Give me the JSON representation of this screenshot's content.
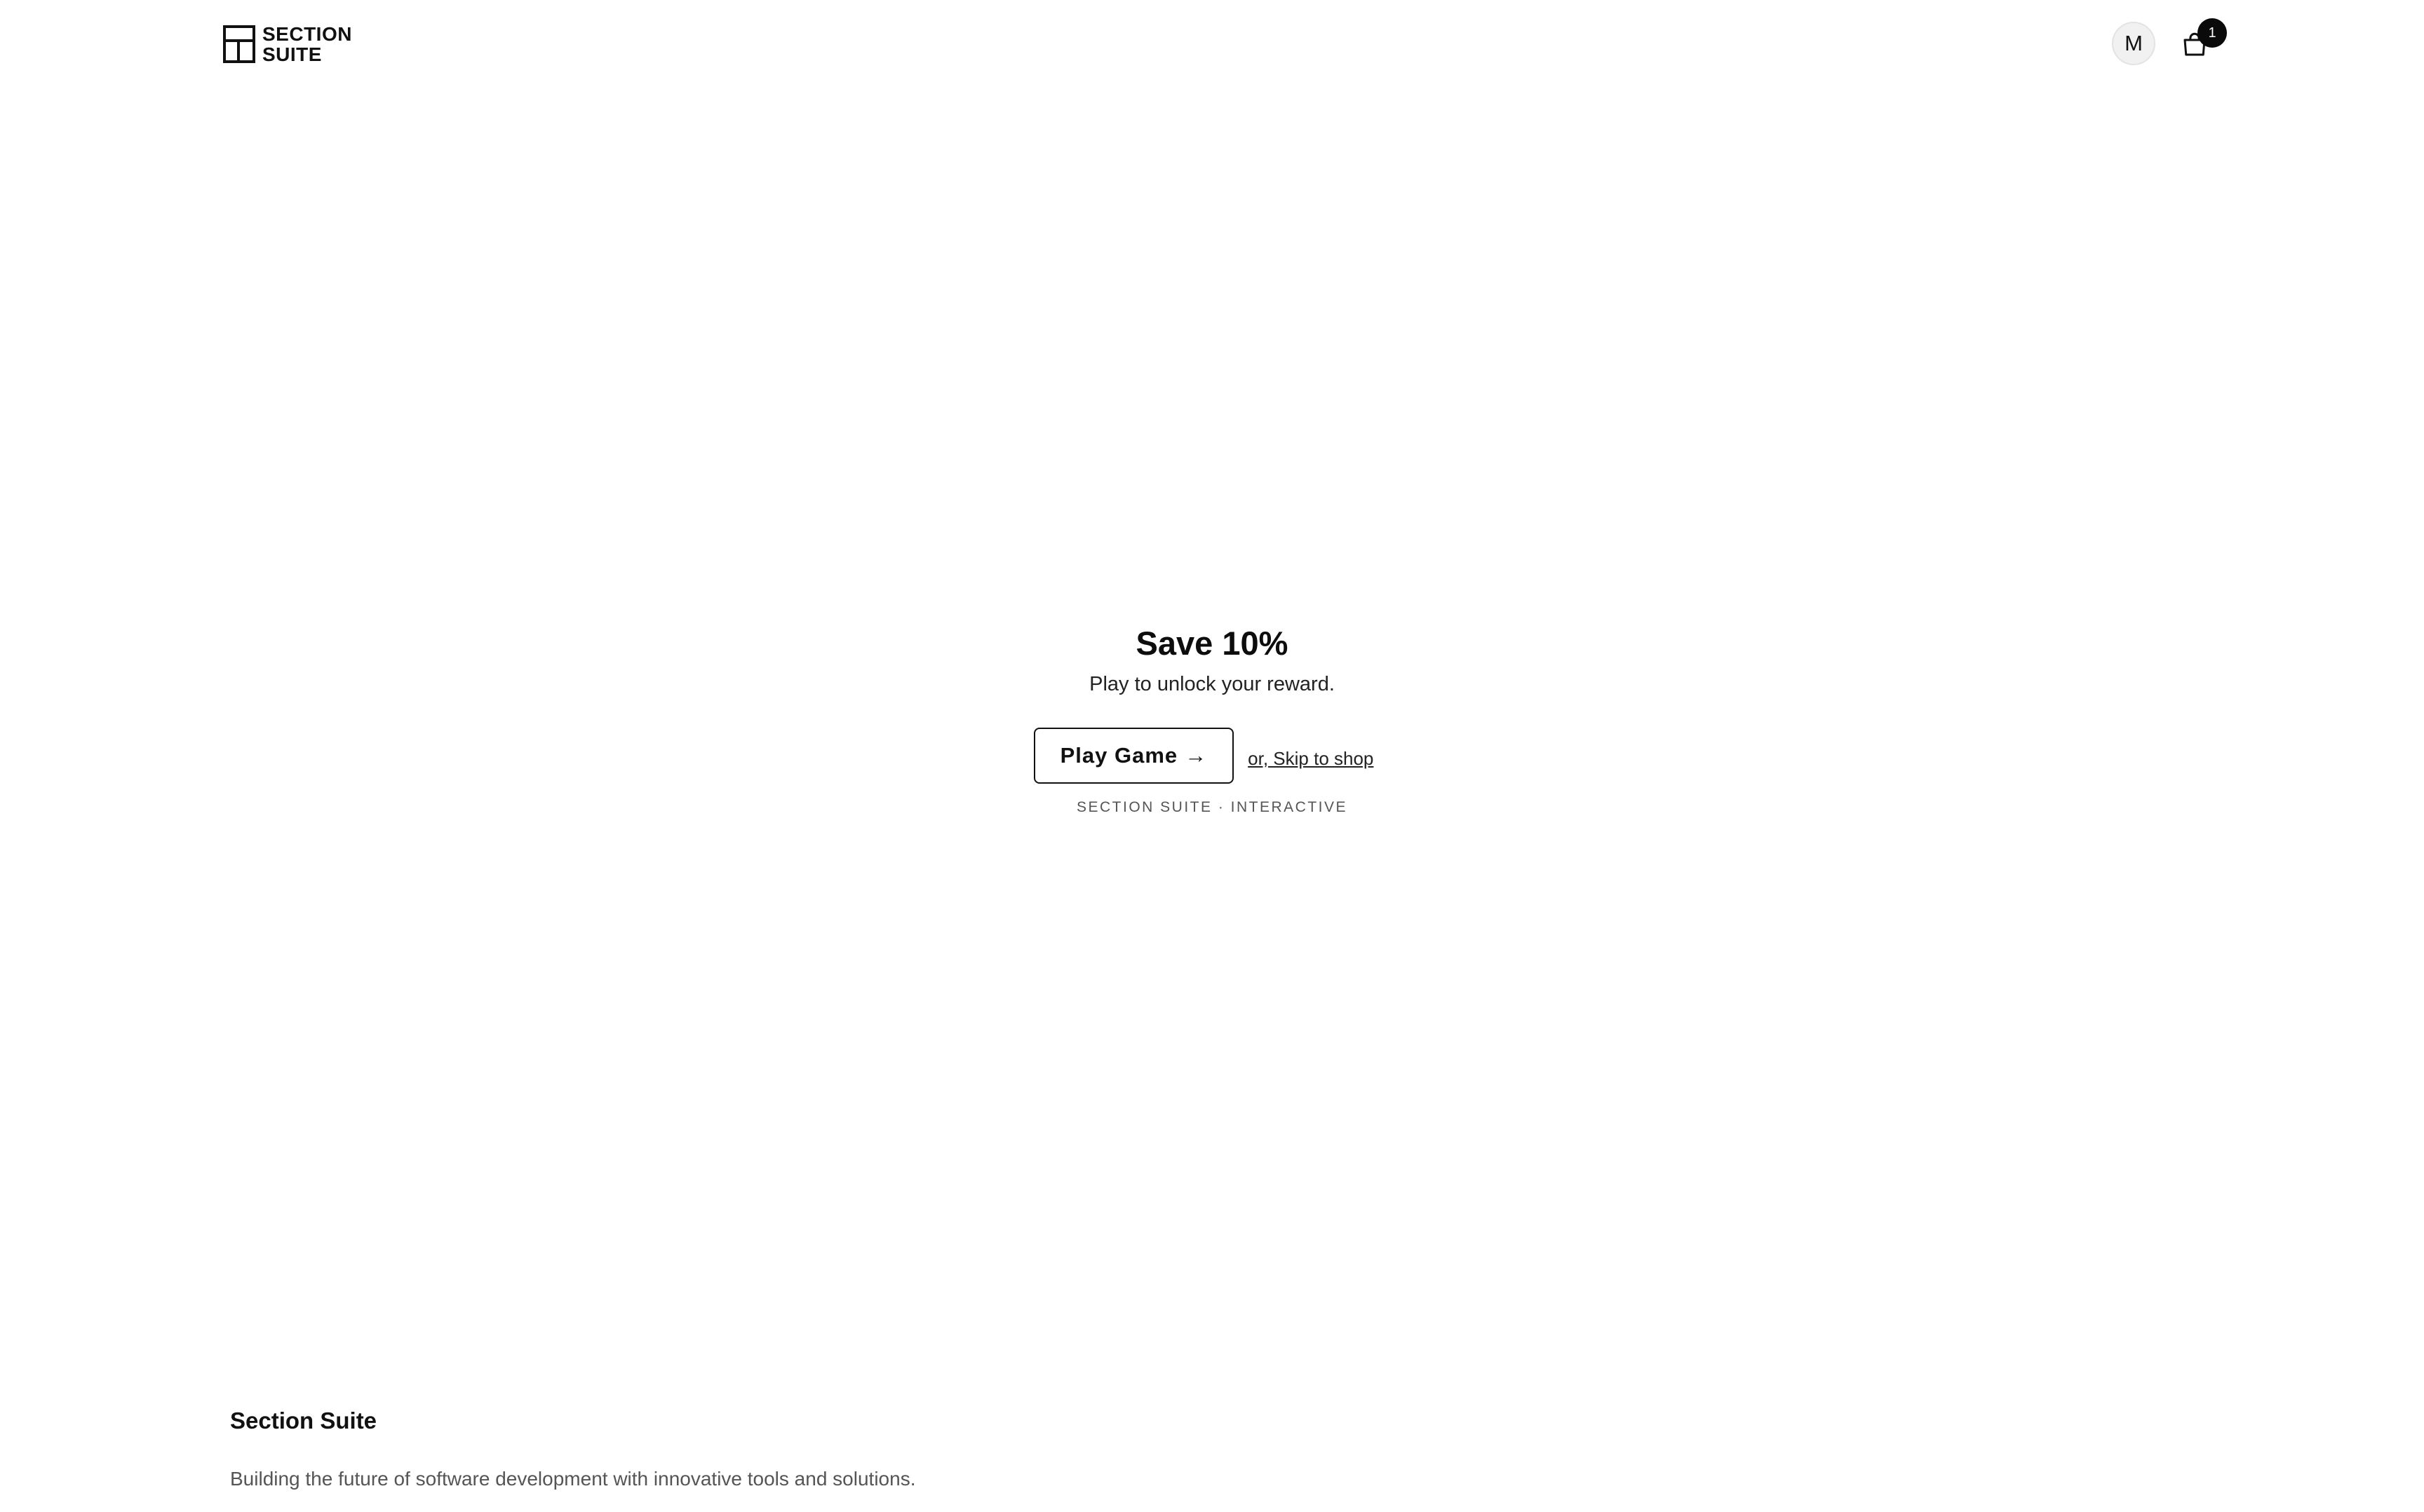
{
  "header": {
    "brand": {
      "line1": "SECTION",
      "line2": "SUITE",
      "icon": "grid-logo-icon"
    },
    "avatar_initial": "M",
    "cart": {
      "icon": "shopping-bag-icon",
      "count": "1"
    }
  },
  "hero": {
    "title": "Save 10%",
    "subtitle": "Play to unlock your reward.",
    "play_button_label": "Play Game",
    "play_button_arrow": "→",
    "skip_link_label": "or, Skip to shop",
    "caption": "SECTION SUITE · INTERACTIVE"
  },
  "footer": {
    "title": "Section Suite",
    "description": "Building the future of software development with innovative tools and solutions."
  },
  "colors": {
    "text": "#111111",
    "muted": "#555555",
    "badge_bg": "#0a0a0a",
    "avatar_bg": "#f1f1f1"
  }
}
